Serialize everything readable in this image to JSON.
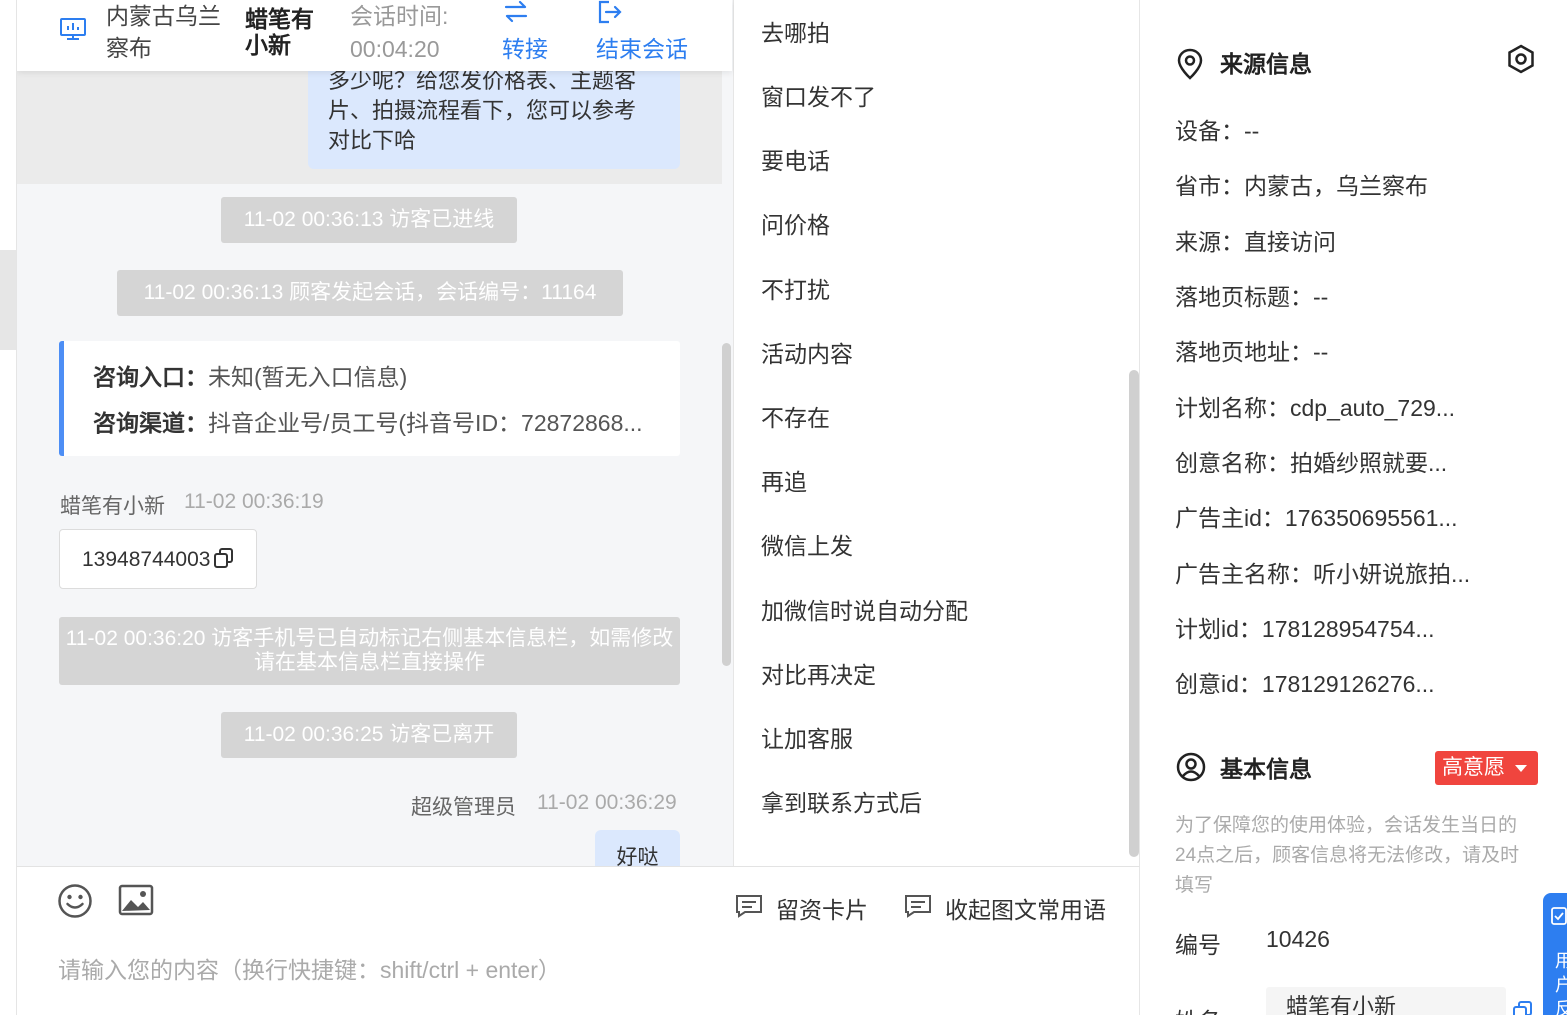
{
  "header": {
    "region": "内蒙古乌兰察布",
    "visitor_name": "蜡笔有小新",
    "session_time_label": "会话时间:",
    "session_time_value": "00:04:20",
    "transfer": "转接",
    "end_session": "结束会话"
  },
  "chat": {
    "top_bubble": "多少呢？给您发价格表、主题客\n片、拍摄流程看下，您可以参考\n对比下哈",
    "sys_msgs": [
      "11-02 00:36:13 访客已进线",
      "11-02 00:36:13 顾客发起会话，会话编号：11164",
      "11-02 00:36:20 访客手机号已自动标记右侧基本信息栏，如需修改请在基本信息栏直接操作",
      "11-02 00:36:25 访客已离开"
    ],
    "entry_card": {
      "entry_label": "咨询入口：",
      "entry_value": "未知(暂无入口信息)",
      "channel_label": "咨询渠道：",
      "channel_value": "抖音企业号/员工号(抖音号ID：72872868..."
    },
    "visitor_msg": {
      "name": "蜡笔有小新",
      "time": "11-02 00:36:19",
      "phone": "13948744003"
    },
    "admin_msg": {
      "name": "超级管理员",
      "time": "11-02 00:36:29",
      "text": "好哒"
    }
  },
  "phrases": [
    "去哪拍",
    "窗口发不了",
    "要电话",
    "问价格",
    "不打扰",
    "活动内容",
    "不存在",
    "再追",
    "微信上发",
    "加微信时说自动分配",
    "对比再决定",
    "让加客服",
    "拿到联系方式后"
  ],
  "input": {
    "card_btn": "留资卡片",
    "collapse_btn": "收起图文常用语",
    "placeholder": "请输入您的内容（换行快捷键：shift/ctrl + enter）"
  },
  "source": {
    "title": "来源信息",
    "rows": [
      "设备：--",
      "省市：内蒙古，乌兰察布",
      "来源：直接访问",
      "落地页标题：--",
      "落地页地址：--",
      "计划名称：cdp_auto_729...",
      "创意名称：拍婚纱照就要...",
      "广告主id：176350695561...",
      "广告主名称：听小妍说旅拍...",
      "计划id：178128954754...",
      "创意id：178129126276..."
    ]
  },
  "basic": {
    "title": "基本信息",
    "intent_tag": "高意愿",
    "note": "为了保障您的使用体验，会话发生当日的24点之后，顾客信息将无法修改，请及时填写",
    "id_label": "编号",
    "id_value": "10426",
    "name_label": "姓名",
    "name_value": "蜡笔有小新"
  },
  "floating_tab": {
    "text": "用户反馈"
  },
  "colors": {
    "accent": "#2d7ef0",
    "intent_tag": "#f0453e",
    "bubble": "#dbe8fd"
  }
}
